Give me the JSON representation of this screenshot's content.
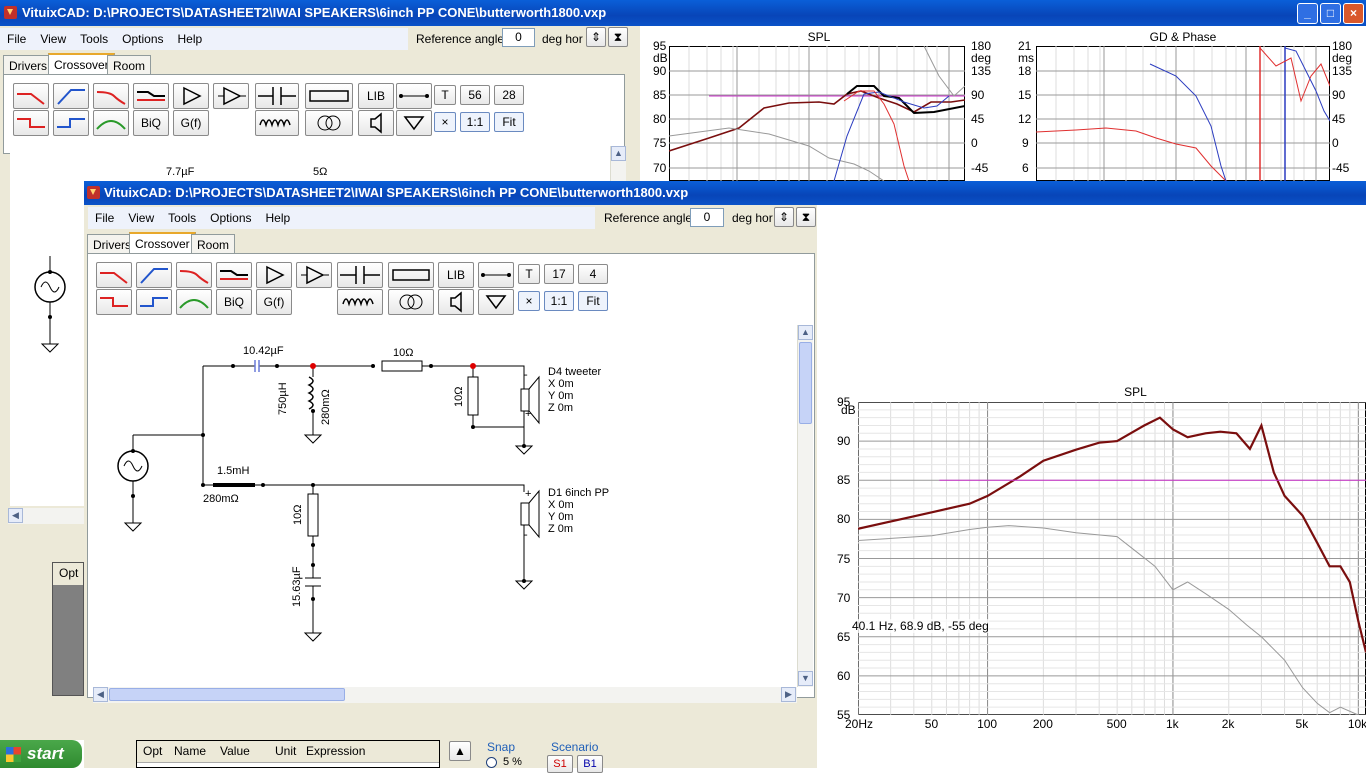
{
  "bg_window": {
    "title": "VituixCAD: D:\\PROJECTS\\DATASHEET2\\IWAI SPEAKERS\\6inch PP CONE\\butterworth1800.vxp",
    "menu": [
      "File",
      "View",
      "Tools",
      "Options",
      "Help"
    ],
    "ref_angle_label": "Reference angle",
    "ref_angle_value": "0",
    "deg_hor": "deg hor",
    "tabs": [
      "Drivers",
      "Crossover",
      "Room"
    ],
    "toolbar": {
      "lib": "LIB",
      "t": "T",
      "n1": "56",
      "n2": "28",
      "biq": "BiQ",
      "gf": "G(f)",
      "one": "1:1",
      "fit": "Fit"
    },
    "partial_cap": "7.7µF",
    "partial_res": "5Ω",
    "opt_label": "Opt",
    "win_buttons": {
      "min": "_",
      "max": "□",
      "close": "×"
    }
  },
  "spl_small": {
    "title": "SPL",
    "left_unit": "dB",
    "right_unit": "deg",
    "left_ticks": [
      "95",
      "90",
      "85",
      "80",
      "75",
      "70"
    ],
    "right_ticks": [
      "180",
      "135",
      "90",
      "45",
      "0",
      "-45"
    ]
  },
  "gd_small": {
    "title": "GD & Phase",
    "left_unit": "ms",
    "right_unit": "deg",
    "left_ticks": [
      "21",
      "18",
      "15",
      "12",
      "9",
      "6"
    ],
    "right_ticks": [
      "180",
      "135",
      "90",
      "45",
      "0",
      "-45"
    ]
  },
  "fg_window": {
    "title": "VituixCAD: D:\\PROJECTS\\DATASHEET2\\IWAI SPEAKERS\\6inch PP CONE\\butterworth1800.vxp",
    "menu": [
      "File",
      "View",
      "Tools",
      "Options",
      "Help"
    ],
    "ref_angle_label": "Reference angle",
    "ref_angle_value": "0",
    "deg_hor": "deg hor",
    "tabs": [
      "Drivers",
      "Crossover",
      "Room"
    ],
    "toolbar": {
      "lib": "LIB",
      "t": "T",
      "n1": "17",
      "n2": "4",
      "biq": "BiQ",
      "gf": "G(f)",
      "one": "1:1",
      "fit": "Fit"
    },
    "schematic": {
      "c1": "10.42µF",
      "r1": "10Ω",
      "l1": "750µH",
      "l1r": "280mΩ",
      "r2": "10Ω",
      "tweeter": {
        "name": "D4 tweeter",
        "x": "X 0m",
        "y": "Y 0m",
        "z": "Z 0m"
      },
      "l2": "1.5mH",
      "l2r": "280mΩ",
      "r3": "10Ω",
      "c2": "15.63µF",
      "woofer": {
        "name": "D1 6inch PP",
        "x": "X 0m",
        "y": "Y 0m",
        "z": "Z 0m"
      }
    },
    "table_headers": [
      "Opt",
      "Name",
      "Value",
      "Unit",
      "Expression"
    ],
    "snap_label": "Snap",
    "snap_value": "5 %",
    "scenario_label": "Scenario",
    "scenario_s": "S1",
    "scenario_b": "B1"
  },
  "spl_big": {
    "title": "SPL",
    "unit": "dB",
    "y_ticks": [
      "95",
      "90",
      "85",
      "80",
      "75",
      "70",
      "65",
      "60",
      "55"
    ],
    "x_ticks": [
      "20Hz",
      "50",
      "100",
      "200",
      "500",
      "1k",
      "2k",
      "5k",
      "10k"
    ],
    "readout": "40.1 Hz, 68.9 dB, -55 deg"
  },
  "chart_data": [
    {
      "type": "line",
      "title": "SPL",
      "xlabel": "",
      "ylabel": "dB",
      "xscale": "log",
      "xlim": [
        20,
        11000
      ],
      "ylim": [
        55,
        95
      ],
      "grid": true,
      "series": [
        {
          "color": "#7a0e0e",
          "x": [
            20,
            50,
            80,
            100,
            150,
            200,
            300,
            400,
            500,
            700,
            850,
            1000,
            1200,
            1500,
            1800,
            2200,
            2600,
            3000,
            3500,
            4000,
            5000,
            6000,
            7000,
            8000,
            9000,
            10000,
            11000
          ],
          "y": [
            78.8,
            80.9,
            82,
            83,
            85.5,
            87.5,
            88.9,
            89.8,
            90,
            92,
            93,
            91.5,
            90.5,
            91,
            91.2,
            91,
            89,
            92,
            86,
            83,
            80.5,
            77,
            74,
            74,
            72,
            67,
            63
          ]
        },
        {
          "color": "#999999",
          "x": [
            20,
            50,
            80,
            100,
            130,
            200,
            300,
            500,
            800,
            1000,
            1200,
            1500,
            2000,
            2500,
            3000,
            4000,
            5000,
            6000,
            7000,
            8000,
            10000
          ],
          "y": [
            77.3,
            77.9,
            78.7,
            79,
            79.2,
            78.9,
            78.3,
            77.8,
            74,
            71,
            72,
            70.5,
            68.5,
            66.5,
            65,
            62,
            58.5,
            56.5,
            55.3,
            56,
            55
          ]
        },
        {
          "color": "#cc33cc",
          "x": [
            55,
            11000
          ],
          "y": [
            85,
            85
          ]
        }
      ]
    }
  ]
}
